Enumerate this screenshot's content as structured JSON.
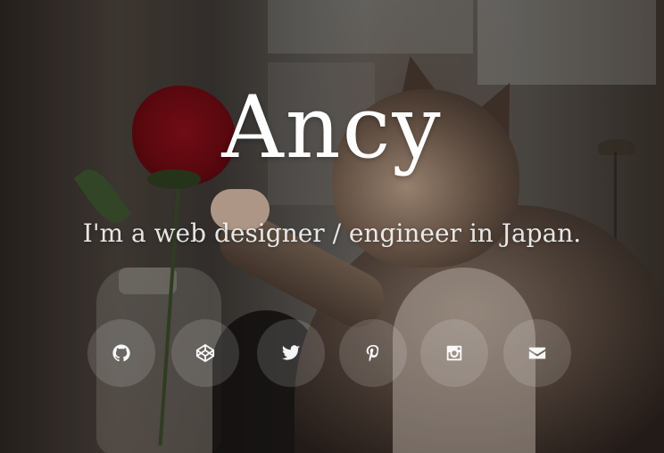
{
  "hero": {
    "title": "Ancy",
    "subtitle": "I'm a web designer / engineer in Japan."
  },
  "social": [
    {
      "name": "github",
      "icon": "github-icon"
    },
    {
      "name": "codepen",
      "icon": "codepen-icon"
    },
    {
      "name": "twitter",
      "icon": "twitter-icon"
    },
    {
      "name": "pinterest",
      "icon": "pinterest-icon"
    },
    {
      "name": "instagram",
      "icon": "instagram-icon"
    },
    {
      "name": "email",
      "icon": "envelope-icon"
    }
  ],
  "colors": {
    "text": "#ffffff",
    "button_bg": "rgba(255,255,255,0.14)"
  }
}
